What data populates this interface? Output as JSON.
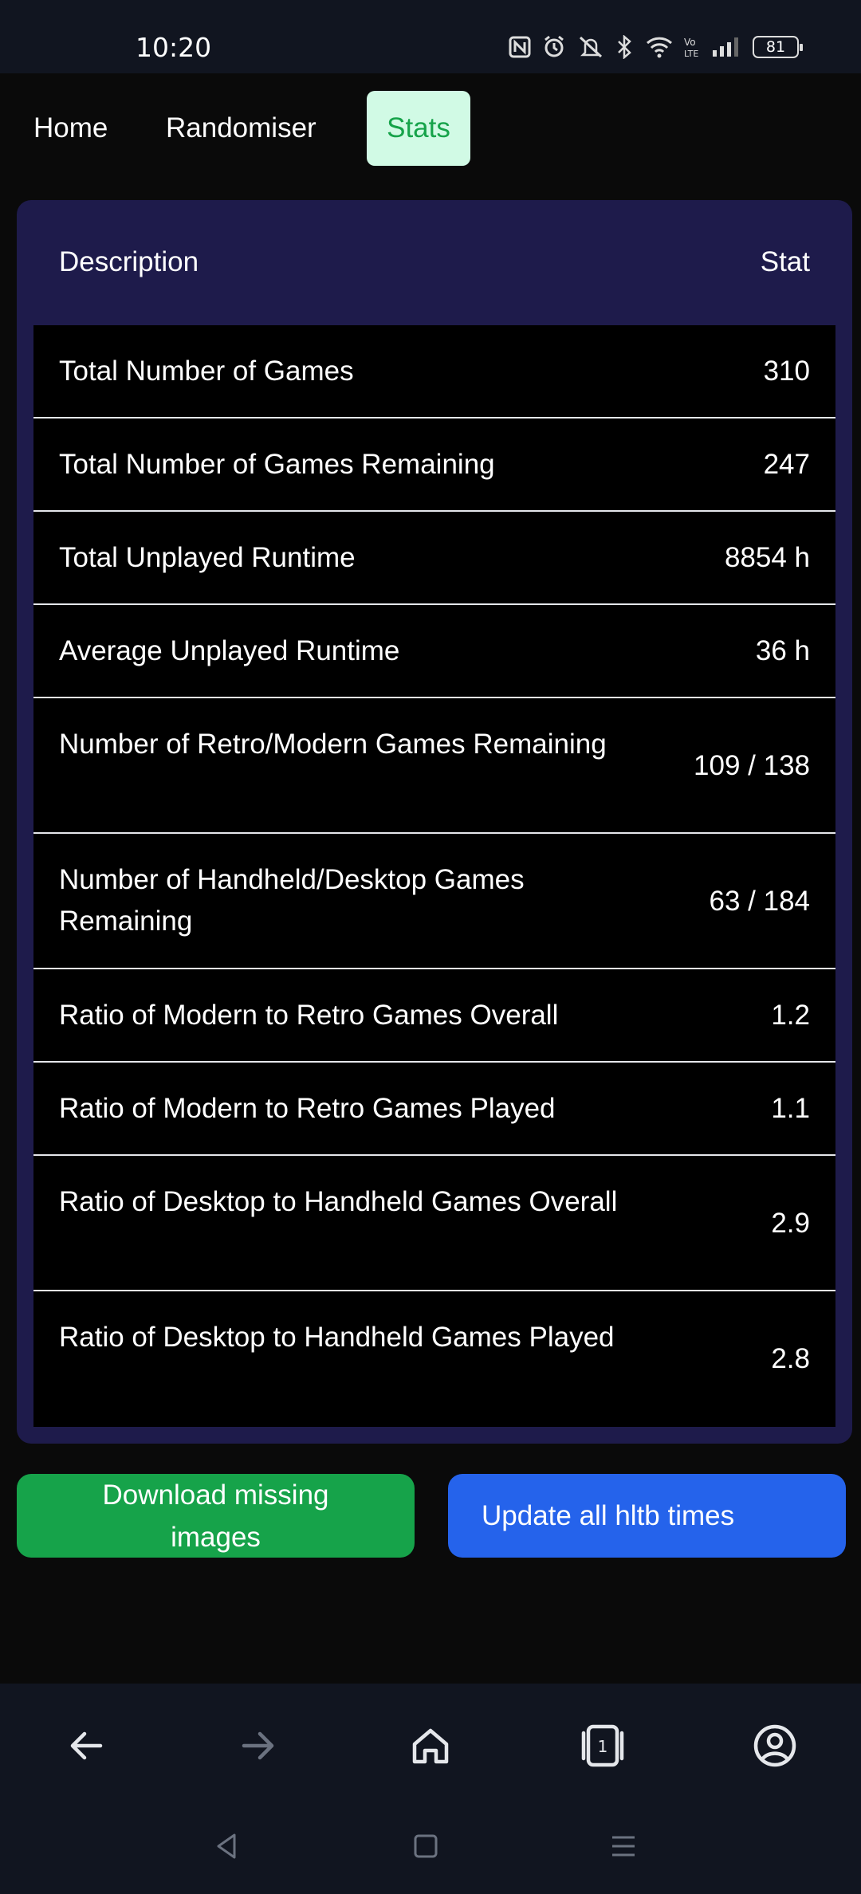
{
  "status_bar": {
    "time": "10:20",
    "battery": "81"
  },
  "nav": {
    "tabs": [
      {
        "label": "Home",
        "active": false
      },
      {
        "label": "Randomiser",
        "active": false
      },
      {
        "label": "Stats",
        "active": true
      }
    ]
  },
  "table": {
    "header_description": "Description",
    "header_stat": "Stat",
    "rows": [
      {
        "description": "Total Number of Games",
        "stat": "310"
      },
      {
        "description": "Total Number of Games Remaining",
        "stat": "247"
      },
      {
        "description": "Total Unplayed Runtime",
        "stat": "8854 h"
      },
      {
        "description": "Average Unplayed Runtime",
        "stat": "36 h"
      },
      {
        "description": "Number of Retro/Modern Games Remaining",
        "stat": "109 / 138"
      },
      {
        "description": "Number of Handheld/Desktop Games Remaining",
        "stat": "63 / 184"
      },
      {
        "description": "Ratio of Modern to Retro Games Overall",
        "stat": "1.2"
      },
      {
        "description": "Ratio of Modern to Retro Games Played",
        "stat": "1.1"
      },
      {
        "description": "Ratio of Desktop to Handheld Games Overall",
        "stat": "2.9"
      },
      {
        "description": "Ratio of Desktop to Handheld Games Played",
        "stat": "2.8"
      }
    ]
  },
  "actions": {
    "download_label": "Download missing images",
    "update_label": "Update all hltb times"
  },
  "browser_bar": {
    "tab_count": "1"
  },
  "colors": {
    "active_tab_bg": "#d1fae5",
    "active_tab_text": "#16a34a",
    "card_bg": "#1e1b4b",
    "green_button": "#16a34a",
    "blue_button": "#2563eb"
  }
}
